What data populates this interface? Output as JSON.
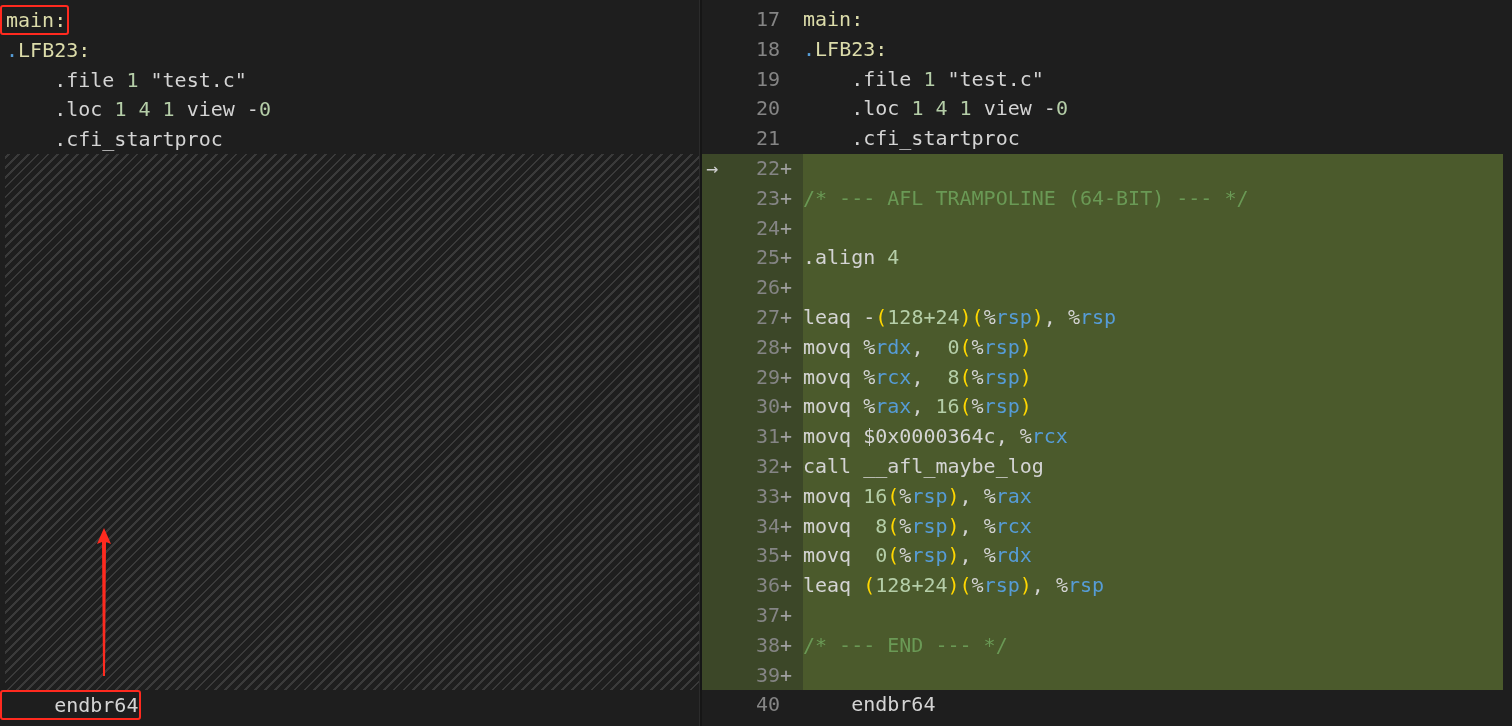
{
  "left_pane": {
    "lines": [
      {
        "kind": "code",
        "boxed": true,
        "tokens": [
          {
            "kind": "label",
            "text": "main:"
          }
        ]
      },
      {
        "kind": "code",
        "boxed": false,
        "tokens": [
          {
            "kind": "dot",
            "text": "."
          },
          {
            "kind": "label",
            "text": "LFB23:"
          }
        ]
      },
      {
        "kind": "code",
        "boxed": false,
        "tokens": [
          {
            "kind": "plain",
            "text": "    .file "
          },
          {
            "kind": "num",
            "text": "1"
          },
          {
            "kind": "plain",
            "text": " \"test.c\""
          }
        ]
      },
      {
        "kind": "code",
        "boxed": false,
        "tokens": [
          {
            "kind": "plain",
            "text": "    .loc "
          },
          {
            "kind": "num",
            "text": "1 4 1"
          },
          {
            "kind": "plain",
            "text": " view -"
          },
          {
            "kind": "num",
            "text": "0"
          }
        ]
      },
      {
        "kind": "code",
        "boxed": false,
        "tokens": [
          {
            "kind": "plain",
            "text": "    .cfi_startproc"
          }
        ]
      },
      {
        "kind": "gap"
      },
      {
        "kind": "code",
        "boxed": true,
        "tokens": [
          {
            "kind": "plain",
            "text": "    endbr64"
          }
        ]
      }
    ]
  },
  "right_pane": {
    "lines": [
      {
        "number": "17",
        "added": false,
        "tokens": [
          {
            "kind": "label",
            "text": "main:"
          }
        ]
      },
      {
        "number": "18",
        "added": false,
        "tokens": [
          {
            "kind": "dot",
            "text": "."
          },
          {
            "kind": "label",
            "text": "LFB23:"
          }
        ]
      },
      {
        "number": "19",
        "added": false,
        "tokens": [
          {
            "kind": "plain",
            "text": "    .file "
          },
          {
            "kind": "num",
            "text": "1"
          },
          {
            "kind": "plain",
            "text": " \"test.c\""
          }
        ]
      },
      {
        "number": "20",
        "added": false,
        "tokens": [
          {
            "kind": "plain",
            "text": "    .loc "
          },
          {
            "kind": "num",
            "text": "1 4 1"
          },
          {
            "kind": "plain",
            "text": " view -"
          },
          {
            "kind": "num",
            "text": "0"
          }
        ]
      },
      {
        "number": "21",
        "added": false,
        "tokens": [
          {
            "kind": "plain",
            "text": "    .cfi_startproc"
          }
        ]
      },
      {
        "number": "22",
        "added": true,
        "sign": "+",
        "marker": "→"
      },
      {
        "number": "23",
        "added": true,
        "sign": "+",
        "tokens": [
          {
            "kind": "comment",
            "text": "/* --- AFL TRAMPOLINE (64-BIT) --- */"
          }
        ]
      },
      {
        "number": "24",
        "added": true,
        "sign": "+"
      },
      {
        "number": "25",
        "added": true,
        "sign": "+",
        "tokens": [
          {
            "kind": "plain",
            "text": ".align "
          },
          {
            "kind": "num",
            "text": "4"
          }
        ]
      },
      {
        "number": "26",
        "added": true,
        "sign": "+"
      },
      {
        "number": "27",
        "added": true,
        "sign": "+",
        "tokens": [
          {
            "kind": "plain",
            "text": "leaq -"
          },
          {
            "kind": "paren",
            "text": "("
          },
          {
            "kind": "num",
            "text": "128+24"
          },
          {
            "kind": "paren",
            "text": ")("
          },
          {
            "kind": "plain",
            "text": "%"
          },
          {
            "kind": "reg",
            "text": "rsp"
          },
          {
            "kind": "paren",
            "text": ")"
          },
          {
            "kind": "plain",
            "text": ", %"
          },
          {
            "kind": "reg",
            "text": "rsp"
          }
        ]
      },
      {
        "number": "28",
        "added": true,
        "sign": "+",
        "tokens": [
          {
            "kind": "plain",
            "text": "movq %"
          },
          {
            "kind": "reg",
            "text": "rdx"
          },
          {
            "kind": "plain",
            "text": ",  "
          },
          {
            "kind": "num",
            "text": "0"
          },
          {
            "kind": "paren",
            "text": "("
          },
          {
            "kind": "plain",
            "text": "%"
          },
          {
            "kind": "reg",
            "text": "rsp"
          },
          {
            "kind": "paren",
            "text": ")"
          }
        ]
      },
      {
        "number": "29",
        "added": true,
        "sign": "+",
        "tokens": [
          {
            "kind": "plain",
            "text": "movq %"
          },
          {
            "kind": "reg",
            "text": "rcx"
          },
          {
            "kind": "plain",
            "text": ",  "
          },
          {
            "kind": "num",
            "text": "8"
          },
          {
            "kind": "paren",
            "text": "("
          },
          {
            "kind": "plain",
            "text": "%"
          },
          {
            "kind": "reg",
            "text": "rsp"
          },
          {
            "kind": "paren",
            "text": ")"
          }
        ]
      },
      {
        "number": "30",
        "added": true,
        "sign": "+",
        "tokens": [
          {
            "kind": "plain",
            "text": "movq %"
          },
          {
            "kind": "reg",
            "text": "rax"
          },
          {
            "kind": "plain",
            "text": ", "
          },
          {
            "kind": "num",
            "text": "16"
          },
          {
            "kind": "paren",
            "text": "("
          },
          {
            "kind": "plain",
            "text": "%"
          },
          {
            "kind": "reg",
            "text": "rsp"
          },
          {
            "kind": "paren",
            "text": ")"
          }
        ]
      },
      {
        "number": "31",
        "added": true,
        "sign": "+",
        "tokens": [
          {
            "kind": "plain",
            "text": "movq $0x0000364c, %"
          },
          {
            "kind": "reg",
            "text": "rcx"
          }
        ]
      },
      {
        "number": "32",
        "added": true,
        "sign": "+",
        "tokens": [
          {
            "kind": "plain",
            "text": "call __afl_maybe_log"
          }
        ]
      },
      {
        "number": "33",
        "added": true,
        "sign": "+",
        "tokens": [
          {
            "kind": "plain",
            "text": "movq "
          },
          {
            "kind": "num",
            "text": "16"
          },
          {
            "kind": "paren",
            "text": "("
          },
          {
            "kind": "plain",
            "text": "%"
          },
          {
            "kind": "reg",
            "text": "rsp"
          },
          {
            "kind": "paren",
            "text": ")"
          },
          {
            "kind": "plain",
            "text": ", %"
          },
          {
            "kind": "reg",
            "text": "rax"
          }
        ]
      },
      {
        "number": "34",
        "added": true,
        "sign": "+",
        "tokens": [
          {
            "kind": "plain",
            "text": "movq  "
          },
          {
            "kind": "num",
            "text": "8"
          },
          {
            "kind": "paren",
            "text": "("
          },
          {
            "kind": "plain",
            "text": "%"
          },
          {
            "kind": "reg",
            "text": "rsp"
          },
          {
            "kind": "paren",
            "text": ")"
          },
          {
            "kind": "plain",
            "text": ", %"
          },
          {
            "kind": "reg",
            "text": "rcx"
          }
        ]
      },
      {
        "number": "35",
        "added": true,
        "sign": "+",
        "tokens": [
          {
            "kind": "plain",
            "text": "movq  "
          },
          {
            "kind": "num",
            "text": "0"
          },
          {
            "kind": "paren",
            "text": "("
          },
          {
            "kind": "plain",
            "text": "%"
          },
          {
            "kind": "reg",
            "text": "rsp"
          },
          {
            "kind": "paren",
            "text": ")"
          },
          {
            "kind": "plain",
            "text": ", %"
          },
          {
            "kind": "reg",
            "text": "rdx"
          }
        ]
      },
      {
        "number": "36",
        "added": true,
        "sign": "+",
        "tokens": [
          {
            "kind": "plain",
            "text": "leaq "
          },
          {
            "kind": "paren",
            "text": "("
          },
          {
            "kind": "num",
            "text": "128+24"
          },
          {
            "kind": "paren",
            "text": ")("
          },
          {
            "kind": "plain",
            "text": "%"
          },
          {
            "kind": "reg",
            "text": "rsp"
          },
          {
            "kind": "paren",
            "text": ")"
          },
          {
            "kind": "plain",
            "text": ", %"
          },
          {
            "kind": "reg",
            "text": "rsp"
          }
        ]
      },
      {
        "number": "37",
        "added": true,
        "sign": "+"
      },
      {
        "number": "38",
        "added": true,
        "sign": "+",
        "tokens": [
          {
            "kind": "comment",
            "text": "/* --- END --- */"
          }
        ]
      },
      {
        "number": "39",
        "added": true,
        "sign": "+"
      },
      {
        "number": "40",
        "added": false,
        "tokens": [
          {
            "kind": "plain",
            "text": "    endbr64"
          }
        ]
      }
    ]
  }
}
